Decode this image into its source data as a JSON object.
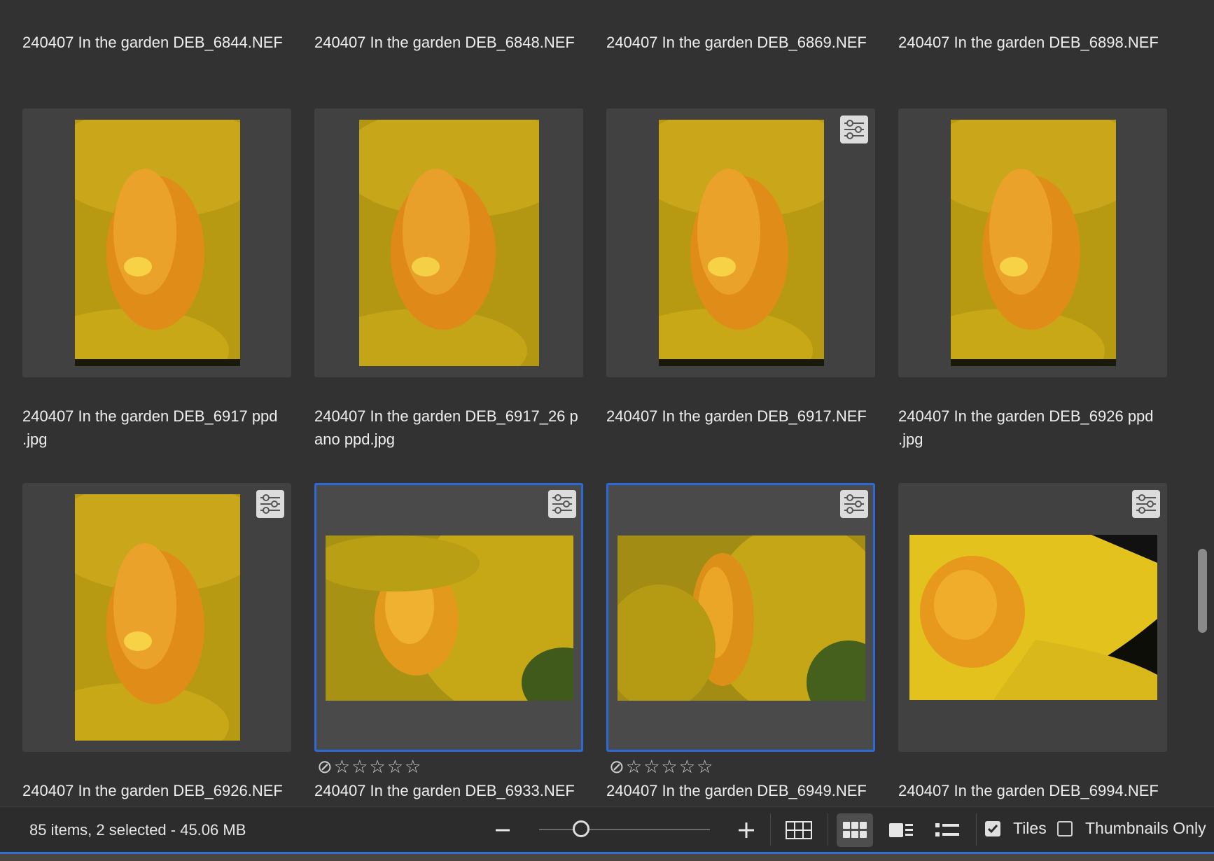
{
  "rows": [
    {
      "items": [
        {
          "name": "240407 In the garden DEB_6844.NEF"
        },
        {
          "name": "240407 In the garden DEB_6848.NEF"
        },
        {
          "name": "240407 In the garden DEB_6869.NEF"
        },
        {
          "name": "240407 In the garden DEB_6898.NEF"
        }
      ]
    },
    {
      "items": [
        {
          "name": "240407 In the garden DEB_6917 ppd\n.jpg",
          "adjusted": false,
          "orientation": "portrait",
          "selected": false
        },
        {
          "name": "240407 In the garden DEB_6917_26 p\nano ppd.jpg",
          "adjusted": false,
          "orientation": "portrait",
          "selected": false
        },
        {
          "name": "240407 In the garden DEB_6917.NEF",
          "adjusted": true,
          "orientation": "portrait",
          "selected": false
        },
        {
          "name": "240407 In the garden DEB_6926 ppd\n.jpg",
          "adjusted": false,
          "orientation": "portrait",
          "selected": false
        }
      ]
    },
    {
      "items": [
        {
          "name": "240407 In the garden DEB_6926.NEF",
          "adjusted": true,
          "orientation": "portrait",
          "selected": false
        },
        {
          "name": "240407 In the garden DEB_6933.NEF",
          "adjusted": true,
          "orientation": "landscape",
          "selected": true,
          "rating_stars": 0
        },
        {
          "name": "240407 In the garden DEB_6949.NEF",
          "adjusted": true,
          "orientation": "landscape",
          "selected": true,
          "rating_stars": 0
        },
        {
          "name": "240407 In the garden DEB_6994.NEF",
          "adjusted": true,
          "orientation": "landscape",
          "selected": false
        }
      ]
    }
  ],
  "status": {
    "summary": "85 items, 2 selected - 45.06 MB"
  },
  "zoom": {
    "minus_icon": "minus-icon",
    "plus_icon": "plus-icon",
    "level": 0.2
  },
  "view_modes": [
    "grid-small-icon",
    "grid-large-icon",
    "filmstrip-icon",
    "list-icon"
  ],
  "active_view": "grid-large-icon",
  "tiles": {
    "label": "Tiles",
    "checked": true
  },
  "thumbnails_only": {
    "label": "Thumbnails Only",
    "checked": false
  },
  "colors": {
    "accent": "#2d6ad6",
    "background": "#323232",
    "tile": "#414141"
  }
}
